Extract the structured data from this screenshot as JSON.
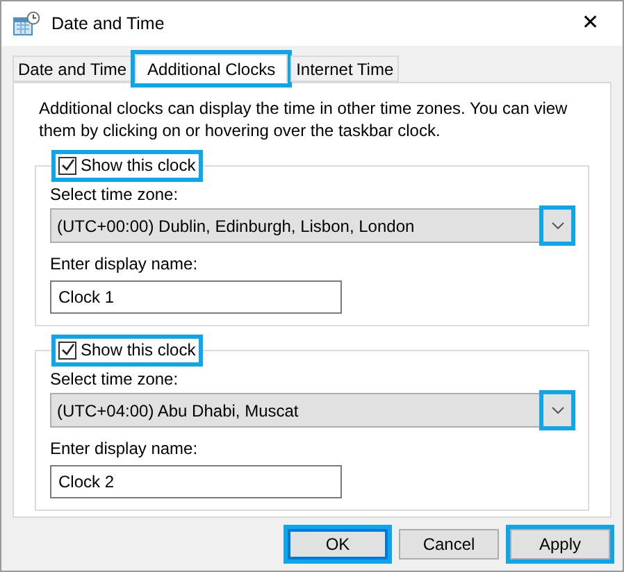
{
  "window": {
    "title": "Date and Time",
    "close": "✕"
  },
  "tabs": [
    {
      "label": "Date and Time",
      "selected": false,
      "highlighted": false
    },
    {
      "label": "Additional Clocks",
      "selected": true,
      "highlighted": true
    },
    {
      "label": "Internet Time",
      "selected": false,
      "highlighted": false
    }
  ],
  "description": "Additional clocks can display the time in other time zones. You can view them by clicking on or hovering over the taskbar clock.",
  "clocks": [
    {
      "show_label": "Show this clock",
      "checked": true,
      "checkbox_highlighted": true,
      "zone_label": "Select time zone:",
      "zone": "(UTC+00:00) Dublin, Edinburgh, Lisbon, London",
      "arrow_highlighted": true,
      "name_label": "Enter display name:",
      "name": "Clock 1"
    },
    {
      "show_label": "Show this clock",
      "checked": true,
      "checkbox_highlighted": true,
      "zone_label": "Select time zone:",
      "zone": "(UTC+04:00) Abu Dhabi, Muscat",
      "arrow_highlighted": true,
      "name_label": "Enter display name:",
      "name": "Clock 2"
    }
  ],
  "buttons": [
    {
      "label": "OK",
      "default": true,
      "highlighted": true
    },
    {
      "label": "Cancel",
      "default": false,
      "highlighted": false
    },
    {
      "label": "Apply",
      "default": false,
      "highlighted": true
    }
  ]
}
